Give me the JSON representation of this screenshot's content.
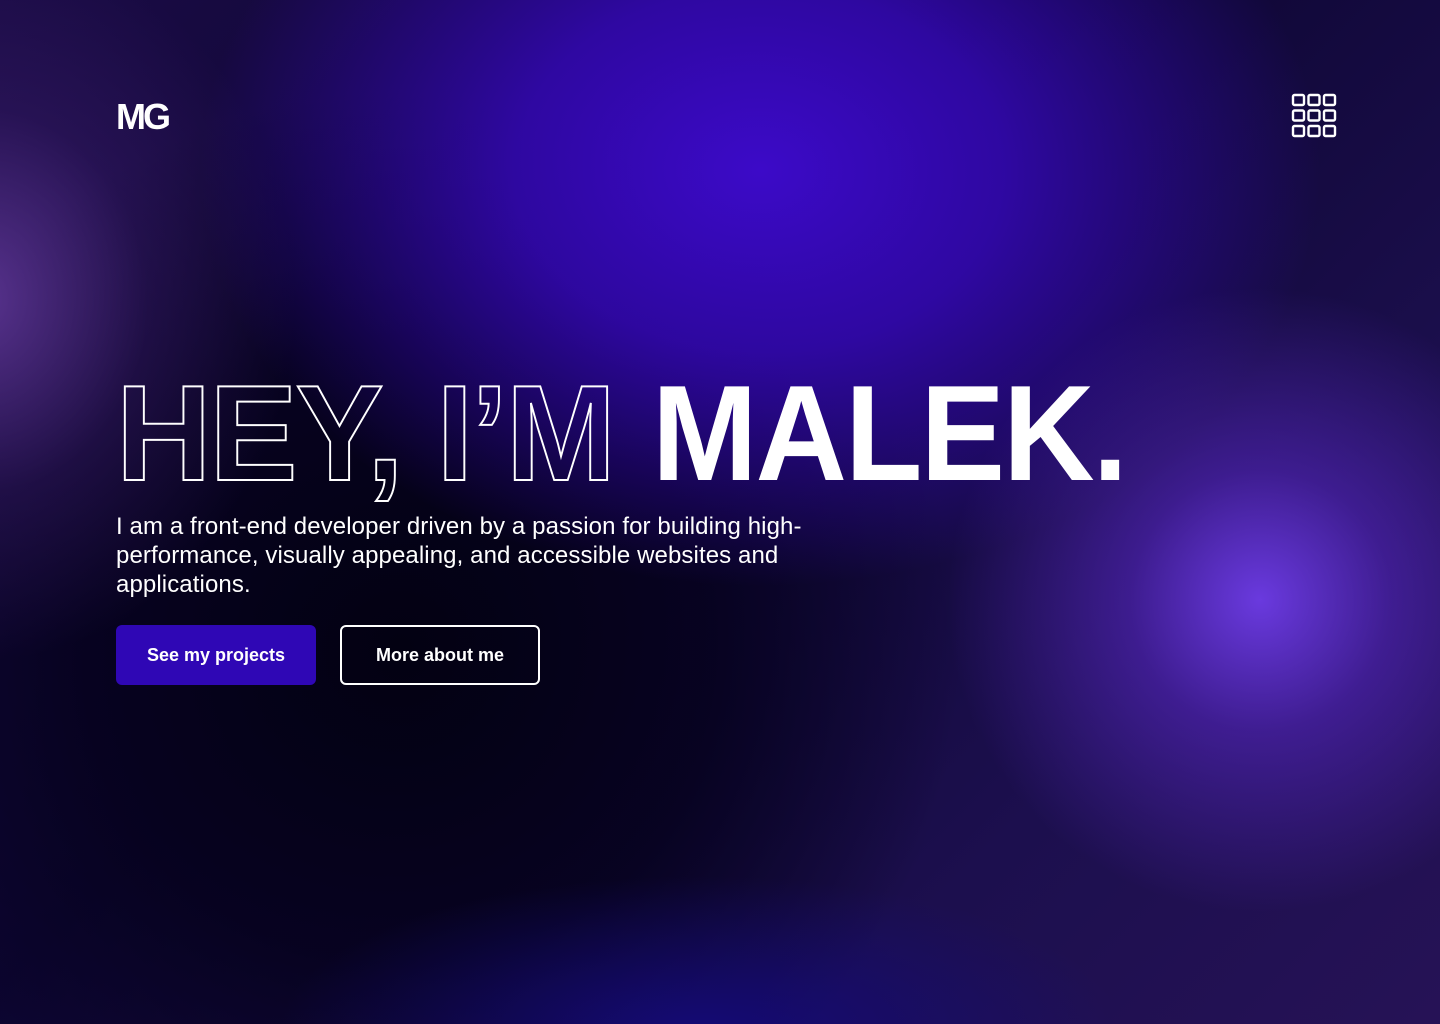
{
  "header": {
    "logo_text": "MG",
    "menu_icon": "grid-menu-icon"
  },
  "hero": {
    "headline_outline": "HEY, I’M",
    "headline_name": "MALEK.",
    "intro": "I am a front-end developer driven by a passion for building high-performance, visually appealing, and accessible websites and applications.",
    "primary_button": "See my projects",
    "secondary_button": "More about me"
  },
  "colors": {
    "primary_button_bg": "#2f07b5",
    "text": "#ffffff",
    "background_dark": "#07031f",
    "glow_purple": "#6e3ce6",
    "glow_blue": "#3c0ac8"
  }
}
